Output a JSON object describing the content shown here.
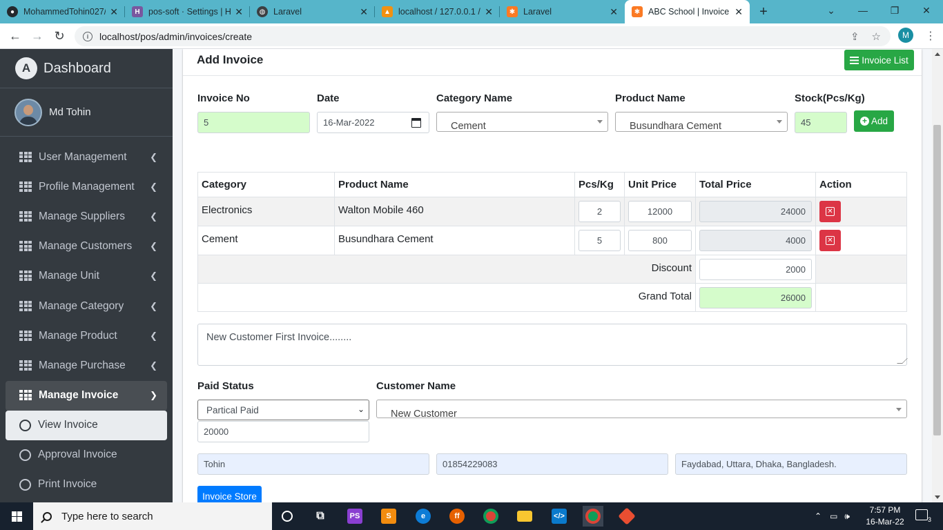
{
  "browser": {
    "tabs": [
      {
        "title": "MohammedTohin027/",
        "icon": "github-icon",
        "color": "#24292e",
        "active": false
      },
      {
        "title": "pos-soft · Settings | He",
        "icon": "heroku-icon",
        "color": "#79589f",
        "active": false
      },
      {
        "title": "Laravel",
        "icon": "globe-icon",
        "color": "#3c4043",
        "active": false
      },
      {
        "title": "localhost / 127.0.0.1 /",
        "icon": "phpmyadmin-icon",
        "color": "#f29111",
        "active": false
      },
      {
        "title": "Laravel",
        "icon": "xampp-icon",
        "color": "#fb7a24",
        "active": false
      },
      {
        "title": "ABC School | Invoice",
        "icon": "xampp-icon",
        "color": "#fb7a24",
        "active": true
      }
    ],
    "url": "localhost/pos/admin/invoices/create",
    "profile_initial": "M"
  },
  "sidebar": {
    "brand": "Dashboard",
    "user": "Md Tohin",
    "menu": [
      {
        "label": "User Management"
      },
      {
        "label": "Profile Management"
      },
      {
        "label": "Manage Suppliers"
      },
      {
        "label": "Manage Customers"
      },
      {
        "label": "Manage Unit"
      },
      {
        "label": "Manage Category"
      },
      {
        "label": "Manage Product"
      },
      {
        "label": "Manage Purchase"
      },
      {
        "label": "Manage Invoice"
      }
    ],
    "submenu": [
      {
        "label": "View Invoice",
        "active": true
      },
      {
        "label": "Approval Invoice",
        "active": false
      },
      {
        "label": "Print Invoice",
        "active": false
      }
    ]
  },
  "card": {
    "title": "Add Invoice",
    "list_button": "Invoice List"
  },
  "form": {
    "invoice_no_label": "Invoice No",
    "invoice_no": "5",
    "date_label": "Date",
    "date": "16-Mar-2022",
    "category_label": "Category Name",
    "category": "Cement",
    "product_label": "Product Name",
    "product": "Busundhara Cement",
    "stock_label": "Stock(Pcs/Kg)",
    "stock": "45",
    "add_button": "Add"
  },
  "table": {
    "headers": [
      "Category",
      "Product Name",
      "Pcs/Kg",
      "Unit Price",
      "Total Price",
      "Action"
    ],
    "rows": [
      {
        "category": "Electronics",
        "product": "Walton Mobile 460",
        "qty": "2",
        "unit_price": "12000",
        "total": "24000"
      },
      {
        "category": "Cement",
        "product": "Busundhara Cement",
        "qty": "5",
        "unit_price": "800",
        "total": "4000"
      }
    ],
    "discount_label": "Discount",
    "discount": "2000",
    "grand_total_label": "Grand Total",
    "grand_total": "26000"
  },
  "description": "New Customer First Invoice........",
  "payment": {
    "paid_status_label": "Paid Status",
    "paid_status": "Partical Paid",
    "paid_amount": "20000",
    "customer_label": "Customer Name",
    "customer": "New Customer",
    "customer_name": "Tohin",
    "customer_mobile": "01854229083",
    "customer_address": "Faydabad, Uttara, Dhaka, Bangladesh.",
    "submit_button": "Invoice Store"
  },
  "taskbar": {
    "search_placeholder": "Type here to search",
    "time": "7:57 PM",
    "date": "16-Mar-22",
    "notification_count": "3"
  },
  "colors": {
    "sidebar_bg": "#343a40",
    "success": "#28a745",
    "danger": "#dc3545",
    "primary": "#007bff",
    "tab_bar": "#56b5ca"
  }
}
